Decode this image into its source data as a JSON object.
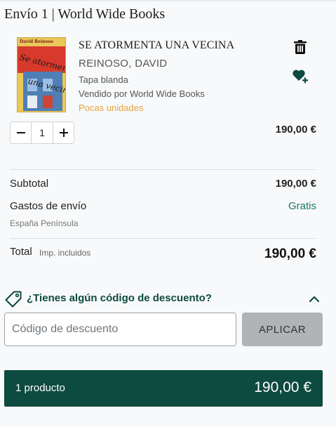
{
  "shipment": {
    "title": "Envío 1 | World Wide Books"
  },
  "product": {
    "cover": {
      "author": "David Reinoso",
      "title_line1": "Se atormenta",
      "title_line2": "una vecina"
    },
    "title": "SE ATORMENTA UNA VECINA",
    "author": "REINOSO, DAVID",
    "format": "Tapa blanda",
    "seller": "Vendido por World Wide Books",
    "stock": "Pocas unidades",
    "quantity": "1",
    "price": "190,00 €",
    "icons": {
      "delete": "trash-icon",
      "wishlist": "heart-plus-icon",
      "decrease": "minus-icon",
      "increase": "plus-icon"
    }
  },
  "totals": {
    "subtotal_label": "Subtotal",
    "subtotal_value": "190,00 €",
    "shipping_label": "Gastos de envío",
    "shipping_value": "Gratis",
    "shipping_region": "España Península",
    "total_label": "Total",
    "total_note": "Imp. incluidos",
    "total_value": "190,00 €"
  },
  "discount": {
    "title": "¿Tienes algún código de descuento?",
    "placeholder": "Código de descuento",
    "apply_label": "APLICAR",
    "icons": {
      "tag": "tag-icon",
      "toggle": "chevron-up-icon"
    }
  },
  "summary": {
    "count_label": "1 producto",
    "total": "190,00 €"
  },
  "colors": {
    "brand_green": "#0d4a3f",
    "accent_green": "#1a7a5e",
    "stock_orange": "#e8a33c",
    "button_grey": "#b1b3b6"
  }
}
